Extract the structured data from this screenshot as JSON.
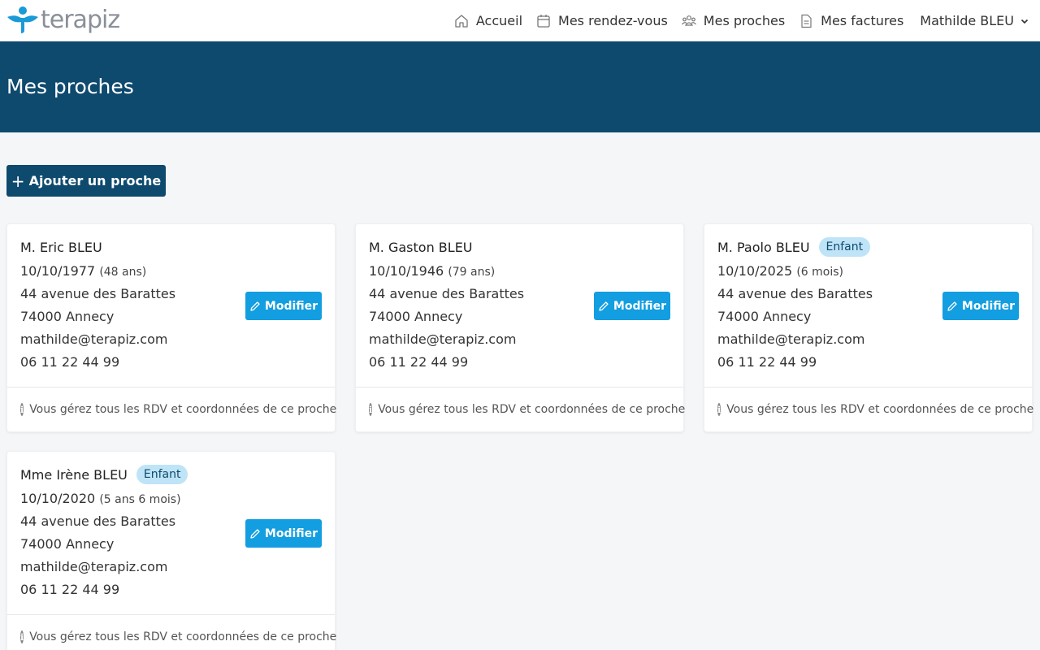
{
  "brand": {
    "name": "terapiz"
  },
  "nav": {
    "items": [
      {
        "label": "Accueil",
        "icon": "home-icon"
      },
      {
        "label": "Mes rendez-vous",
        "icon": "calendar-icon"
      },
      {
        "label": "Mes proches",
        "icon": "people-icon"
      },
      {
        "label": "Mes factures",
        "icon": "document-icon"
      }
    ],
    "user": "Mathilde BLEU"
  },
  "page": {
    "title": "Mes proches"
  },
  "add_button": {
    "label": "Ajouter un proche"
  },
  "cards": [
    {
      "name": "M. Eric BLEU",
      "badge": "",
      "dob": "10/10/1977",
      "age": "(48 ans)",
      "address": "44 avenue des Barattes",
      "city": "74000 Annecy",
      "email": "mathilde@terapiz.com",
      "phone": "06 11 22 44 99",
      "edit_label": "Modifier",
      "footer": "Vous gérez tous les RDV et coordonnées de ce proche"
    },
    {
      "name": "M. Gaston BLEU",
      "badge": "",
      "dob": "10/10/1946",
      "age": "(79 ans)",
      "address": "44 avenue des Barattes",
      "city": "74000 Annecy",
      "email": "mathilde@terapiz.com",
      "phone": "06 11 22 44 99",
      "edit_label": "Modifier",
      "footer": "Vous gérez tous les RDV et coordonnées de ce proche"
    },
    {
      "name": "M. Paolo BLEU",
      "badge": "Enfant",
      "dob": "10/10/2025",
      "age": "(6 mois)",
      "address": "44 avenue des Barattes",
      "city": "74000 Annecy",
      "email": "mathilde@terapiz.com",
      "phone": "06 11 22 44 99",
      "edit_label": "Modifier",
      "footer": "Vous gérez tous les RDV et coordonnées de ce proche"
    },
    {
      "name": "Mme Irène BLEU",
      "badge": "Enfant",
      "dob": "10/10/2020",
      "age": "(5 ans 6 mois)",
      "address": "44 avenue des Barattes",
      "city": "74000 Annecy",
      "email": "mathilde@terapiz.com",
      "phone": "06 11 22 44 99",
      "edit_label": "Modifier",
      "footer": "Vous gérez tous les RDV et coordonnées de ce proche"
    }
  ],
  "colors": {
    "primary_dark": "#0e4a6e",
    "button_blue": "#129ee0",
    "brand_blue": "#1a9ad6",
    "badge_bg": "#bfe4f7"
  }
}
